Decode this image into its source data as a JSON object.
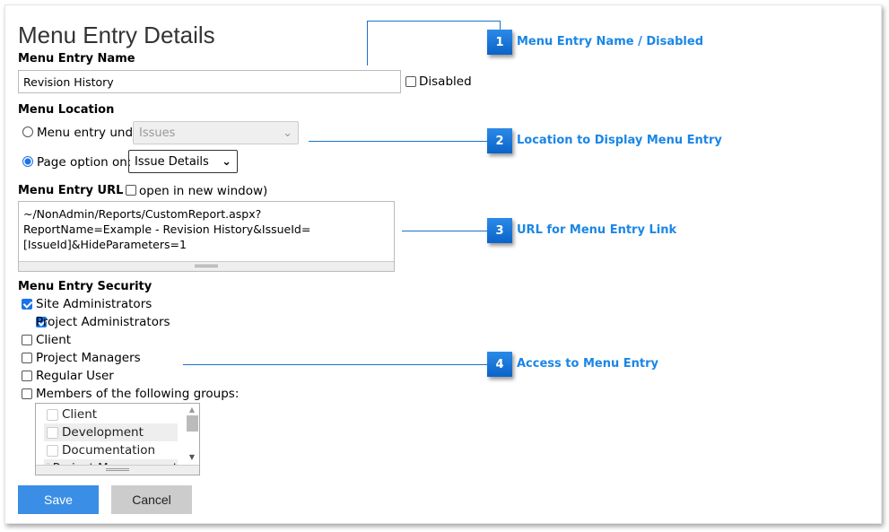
{
  "title": "Menu Entry Details",
  "name": {
    "label": "Menu Entry Name",
    "value": "Revision History",
    "disabled_label": "Disabled",
    "disabled_checked": false
  },
  "location": {
    "label": "Menu Location",
    "under_label": "Menu entry under:",
    "under_value": "Issues",
    "under_selected": false,
    "page_label": "Page option on:",
    "page_value": "Issue Details",
    "page_selected": true
  },
  "url": {
    "label": "Menu Entry URL",
    "paren_open": "(",
    "new_window_label": "open in new window)",
    "new_window_checked": false,
    "value": "~/NonAdmin/Reports/CustomReport.aspx?ReportName=Example - Revision History&IssueId=[IssueId]&HideParameters=1"
  },
  "security": {
    "label": "Menu Entry Security",
    "items": [
      {
        "label": "Site Administrators",
        "checked": true
      },
      {
        "label": "Project Administrators",
        "checked": true
      },
      {
        "label": "Client",
        "checked": false
      },
      {
        "label": "Project Managers",
        "checked": false
      },
      {
        "label": "Regular User",
        "checked": false
      },
      {
        "label": "Members of the following groups:",
        "checked": false
      }
    ],
    "groups": [
      "Client",
      "Development",
      "Documentation",
      "Project Management"
    ]
  },
  "buttons": {
    "save": "Save",
    "cancel": "Cancel"
  },
  "callouts": [
    {
      "number": "1",
      "label": "Menu Entry Name / Disabled"
    },
    {
      "number": "2",
      "label": "Location to Display Menu Entry"
    },
    {
      "number": "3",
      "label": "URL for Menu Entry Link"
    },
    {
      "number": "4",
      "label": "Access to Menu Entry"
    }
  ],
  "colors": {
    "accent": "#3a8ee6",
    "callout": "#1a86e6",
    "cancel_bg": "#cccccc"
  }
}
